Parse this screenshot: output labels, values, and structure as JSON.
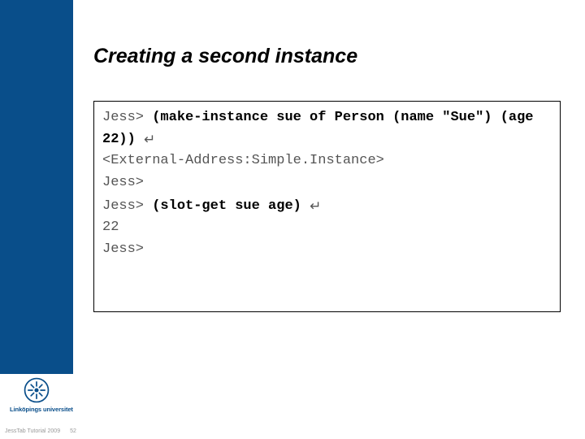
{
  "title": "Creating a second instance",
  "code": {
    "line1_prompt": "Jess> ",
    "line1_cmd": "(make-instance sue of Person (name \"Sue\") (age 22))",
    "line1_enter": "↵",
    "line2_out": "<External-Address:Simple.Instance>",
    "line3": "Jess>",
    "line4_prompt": "Jess> ",
    "line4_cmd": "(slot-get sue age)",
    "line4_enter": "↵",
    "line5_out": "22",
    "line6": "Jess>"
  },
  "logo_text": "Linköpings universitet",
  "footer_text": "JessTab Tutorial 2009",
  "footer_page": "52"
}
